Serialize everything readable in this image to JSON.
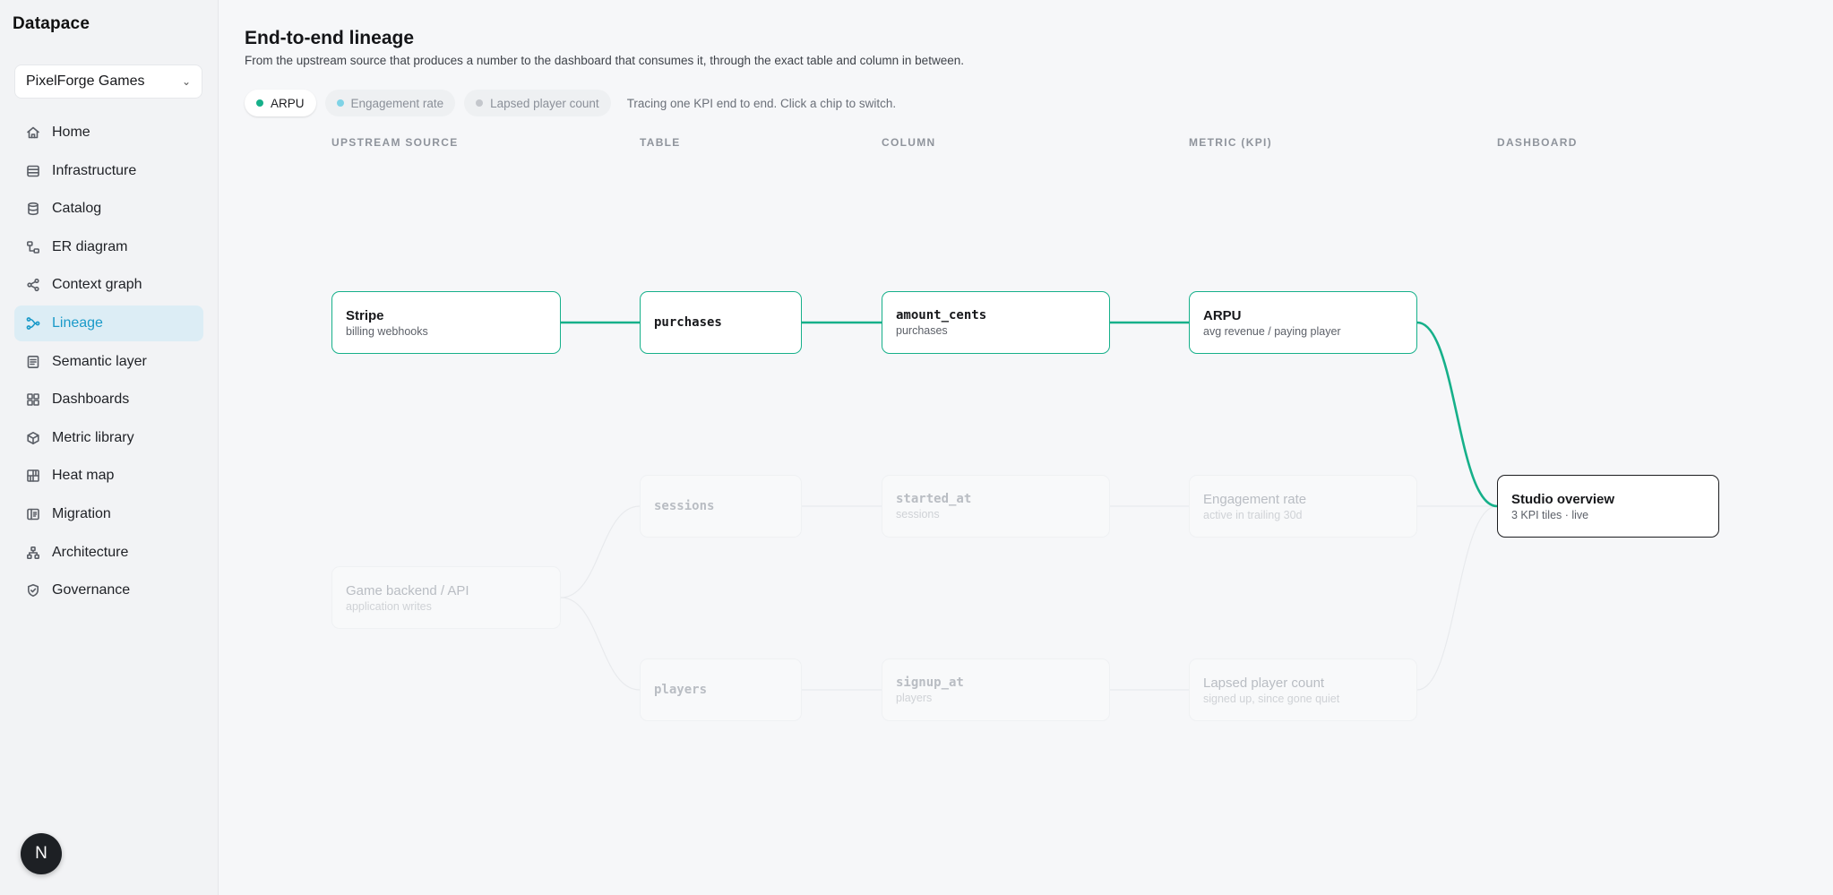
{
  "app": {
    "name": "Datapace"
  },
  "workspace": {
    "name": "PixelForge Games"
  },
  "nav": [
    {
      "label": "Home",
      "icon": "home-icon"
    },
    {
      "label": "Infrastructure",
      "icon": "server-icon"
    },
    {
      "label": "Catalog",
      "icon": "database-icon"
    },
    {
      "label": "ER diagram",
      "icon": "er-diagram-icon"
    },
    {
      "label": "Context graph",
      "icon": "share-graph-icon"
    },
    {
      "label": "Lineage",
      "icon": "lineage-icon",
      "active": true
    },
    {
      "label": "Semantic layer",
      "icon": "document-icon"
    },
    {
      "label": "Dashboards",
      "icon": "grid-icon"
    },
    {
      "label": "Metric library",
      "icon": "cube-icon"
    },
    {
      "label": "Heat map",
      "icon": "heatmap-icon"
    },
    {
      "label": "Migration",
      "icon": "migration-icon"
    },
    {
      "label": "Architecture",
      "icon": "architecture-icon"
    },
    {
      "label": "Governance",
      "icon": "shield-icon"
    }
  ],
  "user": {
    "initial": "N"
  },
  "page": {
    "title": "End-to-end lineage",
    "subtitle": "From the upstream source that produces a number to the dashboard that consumes it, through the exact table and column in between."
  },
  "chips": [
    {
      "label": "ARPU",
      "color": "#16b08a",
      "active": true
    },
    {
      "label": "Engagement rate",
      "color": "#7fd3e6",
      "active": false
    },
    {
      "label": "Lapsed player count",
      "color": "#c4c7cc",
      "active": false
    }
  ],
  "hint": "Tracing one KPI end to end. Click a chip to switch.",
  "columns": [
    "UPSTREAM SOURCE",
    "TABLE",
    "COLUMN",
    "METRIC (KPI)",
    "DASHBOARD"
  ],
  "colors": {
    "accent": "#16b08a",
    "active_nav": "#1a9ac9",
    "dim_edge": "#e8eaed"
  },
  "nodes": {
    "stripe": {
      "title": "Stripe",
      "sub": "billing webhooks"
    },
    "game_backend": {
      "title": "Game backend / API",
      "sub": "application writes"
    },
    "purchases": {
      "title": "purchases"
    },
    "sessions": {
      "title": "sessions"
    },
    "players": {
      "title": "players"
    },
    "amount_cents": {
      "title": "amount_cents",
      "sub": "purchases"
    },
    "started_at": {
      "title": "started_at",
      "sub": "sessions"
    },
    "signup_at": {
      "title": "signup_at",
      "sub": "players"
    },
    "arpu": {
      "title": "ARPU",
      "sub": "avg revenue / paying player"
    },
    "engagement": {
      "title": "Engagement rate",
      "sub": "active in trailing 30d"
    },
    "lapsed": {
      "title": "Lapsed player count",
      "sub": "signed up, since gone quiet"
    },
    "studio": {
      "title": "Studio overview",
      "sub": "3 KPI tiles · live"
    }
  }
}
